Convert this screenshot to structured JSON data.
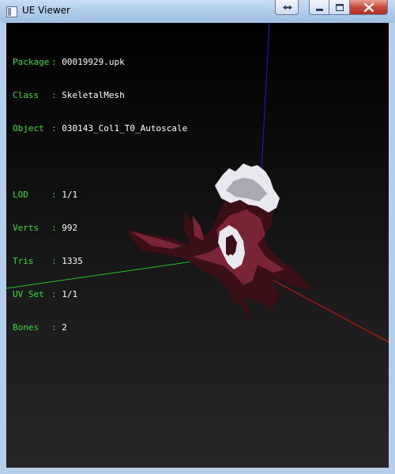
{
  "window": {
    "title": "UE Viewer",
    "icons": {
      "app": "app-icon",
      "restore": "restore-arrows-icon",
      "minimize": "minimize-icon",
      "maximize": "maximize-icon",
      "close": "close-icon"
    }
  },
  "info": {
    "separator": ":",
    "object_group": [
      {
        "label": "Package",
        "value": "00019929.upk"
      },
      {
        "label": "Class",
        "value": "SkeletalMesh"
      },
      {
        "label": "Object",
        "value": "030143_Col1_T0_Autoscale"
      }
    ],
    "stats_group": [
      {
        "label": "LOD",
        "value": "1/1"
      },
      {
        "label": "Verts",
        "value": "992"
      },
      {
        "label": "Tris",
        "value": "1335"
      },
      {
        "label": "UV Set",
        "value": "1/1"
      },
      {
        "label": "Bones",
        "value": "2"
      }
    ]
  },
  "colors": {
    "label_text": "#2ee02e",
    "value_text": "#ffffff",
    "axis_x": "#d11414",
    "axis_y": "#1ec81e",
    "axis_z": "#1a1ae0",
    "mesh_dark": "#3a0f16",
    "mesh_mid": "#7a2535",
    "mesh_light": "#e8e8ee"
  }
}
